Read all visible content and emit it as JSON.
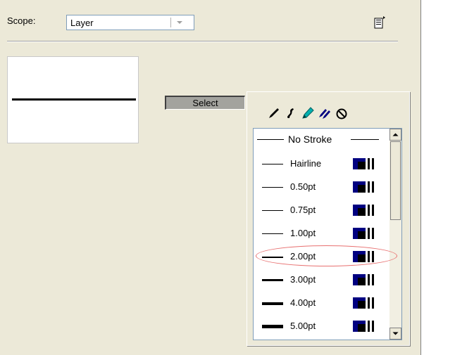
{
  "scope": {
    "label": "Scope:",
    "value": "Layer"
  },
  "preview": {
    "stroke": "black line"
  },
  "select_button": "Select",
  "stroke_menu": {
    "tool_icons": [
      "pen-icon",
      "script-pen-icon",
      "highlighter-icon",
      "double-pen-icon",
      "no-stroke-icon"
    ],
    "no_stroke": "No Stroke",
    "items": [
      {
        "label": "Hairline",
        "icon": "square-tag-icon"
      },
      {
        "label": "0.50pt",
        "icon": "square-tag-icon"
      },
      {
        "label": "0.75pt",
        "icon": "square-tag-icon"
      },
      {
        "label": "1.00pt",
        "icon": "square-tag-icon"
      },
      {
        "label": "2.00pt",
        "icon": "square-tag-icon"
      },
      {
        "label": "3.00pt",
        "icon": "square-tag-icon"
      },
      {
        "label": "4.00pt",
        "icon": "square-tag-icon"
      },
      {
        "label": "5.00pt",
        "icon": "square-tag-icon"
      }
    ],
    "highlighted": "2.00pt"
  },
  "colors": {
    "panel_bg": "#ece9d8",
    "tag_navy": "#000080",
    "highlight": "#e87070",
    "accent_cyan": "#00b0b0"
  }
}
